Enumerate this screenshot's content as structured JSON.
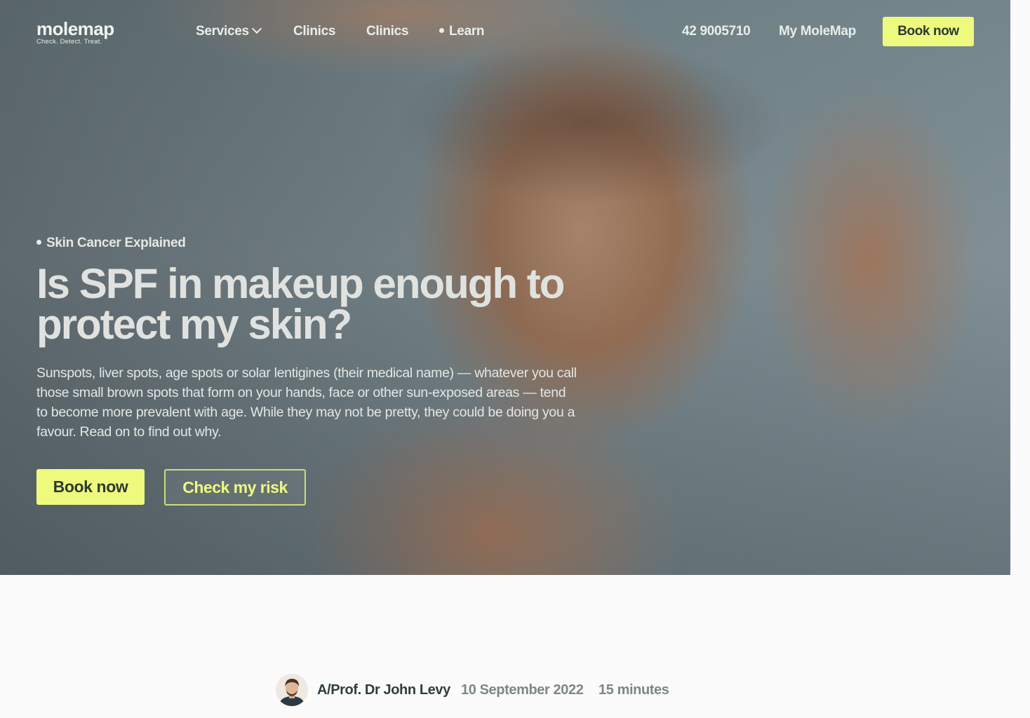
{
  "brand": {
    "name": "molemap",
    "tagline": "Check. Detect. Treat."
  },
  "nav": {
    "items": [
      {
        "label": "Services",
        "has_dropdown": true
      },
      {
        "label": "Clinics"
      },
      {
        "label": "Clinics"
      },
      {
        "label": "Learn",
        "active": true
      }
    ],
    "phone": "42 9005710",
    "account": "My MoleMap",
    "cta": "Book now"
  },
  "hero": {
    "eyebrow": "Skin Cancer Explained",
    "headline": "Is SPF in makeup enough to protect my skin?",
    "lead": "Sunspots, liver spots, age spots or solar lentigines (their medical name) — whatever you call those small brown spots that form on your hands, face or other sun-exposed areas — tend to become more prevalent with age. While they may not be pretty, they could be doing you a favour. Read on to find out why.",
    "primary_cta": "Book now",
    "secondary_cta": "Check my risk"
  },
  "byline": {
    "author": "A/Prof. Dr John Levy",
    "date": "10 September 2022",
    "read_time": "15 minutes"
  },
  "colors": {
    "accent": "#eefa7e",
    "text_dark": "#2f3f38",
    "muted": "#7d8883"
  }
}
